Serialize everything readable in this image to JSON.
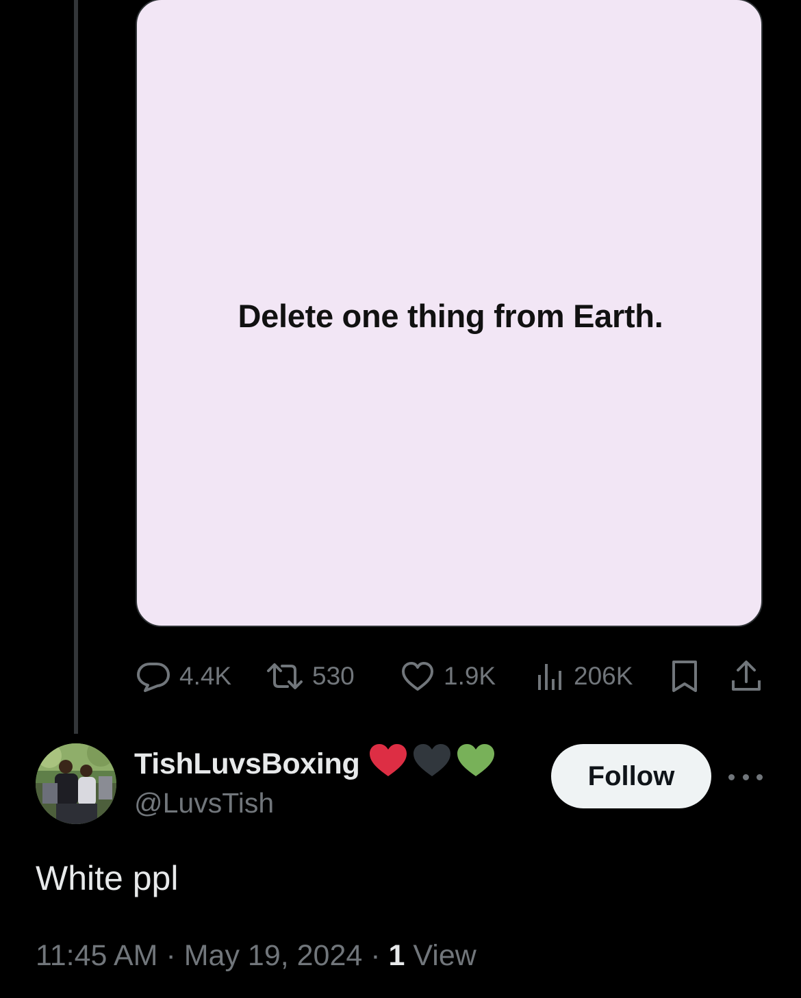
{
  "media": {
    "text": "Delete one thing from Earth.",
    "background": "#f2e6f5"
  },
  "actions": {
    "replies": {
      "icon": "reply-icon",
      "count": "4.4K"
    },
    "reposts": {
      "icon": "repost-icon",
      "count": "530"
    },
    "likes": {
      "icon": "heart-icon",
      "count": "1.9K"
    },
    "views": {
      "icon": "analytics-icon",
      "count": "206K"
    },
    "bookmark": {
      "icon": "bookmark-icon"
    },
    "share": {
      "icon": "share-icon"
    }
  },
  "author": {
    "display_name": "TishLuvsBoxing",
    "name_emojis": [
      {
        "icon": "red-heart-icon",
        "color": "#dd2e44"
      },
      {
        "icon": "black-heart-icon",
        "color": "#31373d"
      },
      {
        "icon": "green-heart-icon",
        "color": "#78b159"
      }
    ],
    "handle": "@LuvsTish",
    "avatar": "profile-photo"
  },
  "follow_button": {
    "label": "Follow"
  },
  "more_button": {
    "icon": "more-horizontal-icon"
  },
  "tweet": {
    "text": "White ppl"
  },
  "meta": {
    "time": "11:45 AM",
    "separator": " · ",
    "date": "May 19, 2024",
    "views_count": "1",
    "views_label": " View"
  },
  "colors": {
    "background": "#000000",
    "primary_text": "#e7e9ea",
    "secondary_text": "#71767b",
    "thread_line": "#333639"
  }
}
